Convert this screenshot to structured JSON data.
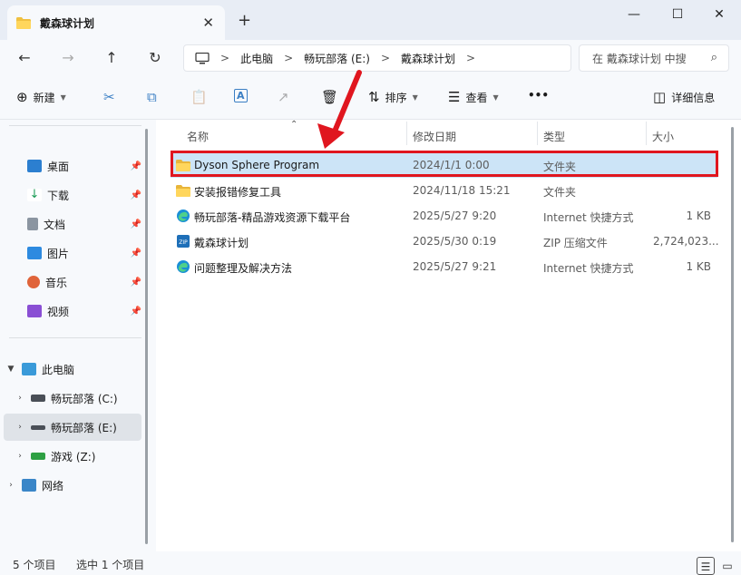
{
  "window": {
    "tab_title": "戴森球计划",
    "new_tab": "+",
    "minimize": "—",
    "maximize": "☐",
    "close": "✕",
    "tab_close": "✕"
  },
  "nav": {
    "back": "←",
    "forward": "→",
    "up": "↑",
    "refresh": "↻",
    "breadcrumbs": [
      "此电脑",
      "畅玩部落 (E:)",
      "戴森球计划"
    ],
    "sep": ">",
    "search_placeholder": "在 戴森球计划 中搜",
    "search_icon": "⌕"
  },
  "toolbar": {
    "new_label": "新建",
    "sort_label": "排序",
    "view_label": "查看",
    "more_label": "•••",
    "details_label": "详细信息",
    "icons": {
      "new": "⊕",
      "cut": "✂",
      "copy": "⧉",
      "paste": "📋",
      "rename": "A",
      "share": "↗",
      "delete": "🗑",
      "sort": "⇅",
      "view": "☰",
      "details": "◫"
    }
  },
  "sidebar": {
    "quick": [
      {
        "label": "桌面",
        "icon": "desktop-icon",
        "color": "#2c7fd0"
      },
      {
        "label": "下载",
        "icon": "download-icon",
        "color": "#1a9b55"
      },
      {
        "label": "文档",
        "icon": "documents-icon",
        "color": "#7a8593"
      },
      {
        "label": "图片",
        "icon": "pictures-icon",
        "color": "#2d8ae0"
      },
      {
        "label": "音乐",
        "icon": "music-icon",
        "color": "#e0643a"
      },
      {
        "label": "视频",
        "icon": "videos-icon",
        "color": "#8a4fd4"
      }
    ],
    "pin": "📌",
    "this_pc": "此电脑",
    "drives": [
      {
        "label": "畅玩部落 (C:)",
        "icon": "windows-drive-icon"
      },
      {
        "label": "畅玩部落 (E:)",
        "icon": "drive-icon"
      },
      {
        "label": "游戏 (Z:)",
        "icon": "drive-icon"
      }
    ],
    "network": "网络",
    "chev_right": "›",
    "chev_down": "⌄"
  },
  "columns": {
    "name": "名称",
    "modified": "修改日期",
    "type": "类型",
    "size": "大小"
  },
  "files": [
    {
      "name": "Dyson Sphere Program",
      "modified": "2024/1/1 0:00",
      "type": "文件夹",
      "size": "",
      "icon": "folder-icon"
    },
    {
      "name": "安装报错修复工具",
      "modified": "2024/11/18 15:21",
      "type": "文件夹",
      "size": "",
      "icon": "folder-icon"
    },
    {
      "name": "畅玩部落-精品游戏资源下载平台",
      "modified": "2025/5/27 9:20",
      "type": "Internet 快捷方式",
      "size": "1 KB",
      "icon": "edge-icon"
    },
    {
      "name": "戴森球计划",
      "modified": "2025/5/30 0:19",
      "type": "ZIP 压缩文件",
      "size": "2,724,023...",
      "icon": "zip-icon"
    },
    {
      "name": "问题整理及解决方法",
      "modified": "2025/5/27 9:21",
      "type": "Internet 快捷方式",
      "size": "1 KB",
      "icon": "edge-icon"
    }
  ],
  "status": {
    "count": "5 个项目",
    "selected": "选中 1 个项目"
  },
  "colors": {
    "accent": "#0067c0",
    "selection": "#cce4f7",
    "annotation": "#e0161f",
    "folder": "#f0c040"
  }
}
